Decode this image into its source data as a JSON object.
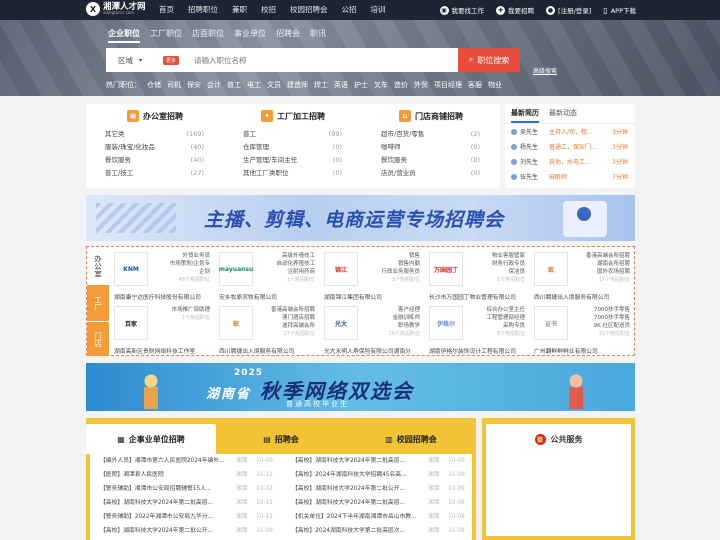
{
  "brand": {
    "name_cn": "湘潭人才网",
    "name_en": "xiangtanrc.com",
    "mark": "X"
  },
  "topnav": [
    "首页",
    "招聘职位",
    "兼职",
    "校招",
    "校园招聘会",
    "公招",
    "培训"
  ],
  "topright": {
    "find_job": "我要找工作",
    "hire": "我要招聘",
    "login": "[注册/登录]",
    "app": "APP下载"
  },
  "search": {
    "tabs": [
      "企业职位",
      "工厂职位",
      "店面职位",
      "事业单位",
      "招聘会",
      "职讯"
    ],
    "region_label": "区域",
    "more_badge": "更多",
    "placeholder": "请输入职位名称",
    "button": "职位搜索",
    "advanced": "高级搜索"
  },
  "hot": {
    "label": "热门职位：",
    "items": [
      "仓储",
      "司机",
      "保安",
      "会计",
      "普工",
      "电工",
      "文员",
      "建造师",
      "焊工",
      "英语",
      "护士",
      "叉车",
      "造价",
      "外贸",
      "项目经理",
      "客服",
      "物业"
    ]
  },
  "categories": [
    {
      "title": "办公室招聘",
      "icon": "briefcase-icon",
      "rows": [
        [
          "其它类",
          "(169)"
        ],
        [
          "服装/珠宝/化妆品",
          "(40)"
        ],
        [
          "餐饮服务",
          "(40)"
        ],
        [
          "普工/技工",
          "(27)"
        ]
      ]
    },
    {
      "title": "工厂加工招聘",
      "icon": "wrench-icon",
      "rows": [
        [
          "普工",
          "(99)"
        ],
        [
          "仓库管理",
          "(0)"
        ],
        [
          "生产管理/车间主任",
          "(0)"
        ],
        [
          "其他工厂类职位",
          "(0)"
        ]
      ]
    },
    {
      "title": "门店商铺招聘",
      "icon": "store-icon",
      "rows": [
        [
          "超市/百货/零售",
          "(2)"
        ],
        [
          "咖啡师",
          "(0)"
        ],
        [
          "餐饮服务",
          "(0)"
        ],
        [
          "店员/营业员",
          "(0)"
        ]
      ]
    }
  ],
  "resume": {
    "tabs": [
      "最新简历",
      "最新动态"
    ],
    "rows": [
      {
        "name": "吴先生",
        "job": "主持人/司，租...",
        "time": "3分钟"
      },
      {
        "name": "杨先生",
        "job": "普通工，保安门...",
        "time": "3分钟"
      },
      {
        "name": "刘先生",
        "job": "其他，水电工...",
        "time": "3分钟"
      },
      {
        "name": "伍先生",
        "job": "麻醉师",
        "time": "7分钟"
      }
    ]
  },
  "banner1": {
    "text": "主播、剪辑、电商运营专场招聘会"
  },
  "logo_side": {
    "office": "办公室",
    "factory": "工厂",
    "store": "门店"
  },
  "companies": [
    {
      "logo": "KNM",
      "color": "#1a55a5",
      "jobs": [
        "外贸业务员",
        "市场策划/企划专",
        "企划"
      ],
      "hot": "46个热招职位",
      "name": "湖南康宁达医疗科技股份有限公司"
    },
    {
      "logo": "mayuansu",
      "color": "#1a8a6a",
      "jobs": [
        "高级外墙技工",
        "自动化养殖技工",
        "注射用药商"
      ],
      "hot": "1个热招职位",
      "name": "安乡牧原农牧有限公司"
    },
    {
      "logo": "锦江",
      "color": "#c8362a",
      "jobs": [
        "销售",
        "销售内勤",
        "行政业务服务员"
      ],
      "hot": "3个热招职位",
      "name": "湖南锦江集团有限公司"
    },
    {
      "logo": "万国园丁",
      "color": "#cc2a2a",
      "jobs": [
        "物业客服管家",
        "财务行政专员",
        "保洁员"
      ],
      "hot": "1个热招职位",
      "name": "长沙市万国园丁物业管理有限公司"
    },
    {
      "logo": "蚁",
      "color": "#e8712a",
      "jobs": [
        "香港高端会所招聘",
        "湖南会所招聘",
        "国外农场招聘"
      ],
      "hot": "17个热招职位",
      "name": "西川聘捷出入境服务有限公司"
    },
    {
      "logo": "百家",
      "color": "#222",
      "jobs": [
        "市场推广部助理"
      ],
      "hot": "1个热招职位",
      "name": "湖南高新区贵财网络科技工作室"
    },
    {
      "logo": "蚁",
      "color": "#e8712a",
      "jobs": [
        "香港高端会所招聘",
        "澳门酒店招聘",
        "迪拜高端会所"
      ],
      "hot": "17个热招职位",
      "name": "西川聘捷出入境服务有限公司"
    },
    {
      "logo": "光大",
      "color": "#2d5c8a",
      "jobs": [
        "客户经理",
        "金融训练师",
        "职场教学"
      ],
      "hot": "16个热招职位",
      "name": "光大永明人寿保险有限公司湖南分"
    },
    {
      "logo": "伊格尔",
      "color": "#6a8fc8",
      "jobs": [
        "综合办公室主任",
        "工程管理部经理",
        "采购专员"
      ],
      "hot": "8个热招职位",
      "name": "湖南伊格尔装饰设计工程有限公司"
    },
    {
      "logo": "证书",
      "color": "#999",
      "jobs": [
        "7000扶手零售",
        "7000扶手零售",
        "9K 社区配送员"
      ],
      "hot": "31个热招职位",
      "name": "广州翻鲜鲜鲜业有限公司"
    }
  ],
  "banner2": {
    "year": "2025",
    "prefix": "湖南省",
    "title": "秋季网络双选会",
    "sub": "普通高校毕业生"
  },
  "bottom": {
    "tabs": [
      "企事业单位招聘",
      "招聘会",
      "校园招聘会"
    ],
    "left": [
      {
        "t": "【编外人员】湘潭市第六人民医院2024年编外...",
        "s": "湘潭",
        "d": "10-09"
      },
      {
        "t": "【医院】湘潭县人民医院",
        "s": "湘潭",
        "d": "10-12"
      },
      {
        "t": "【警务辅助】湘潭市公安局招聘辅警15人...",
        "s": "湘潭",
        "d": "10-12"
      },
      {
        "t": "【高校】湖南科技大学2024年第二批高层...",
        "s": "湘潭",
        "d": "10-11"
      },
      {
        "t": "【警务辅助】2022年湘潭市公安局九华分...",
        "s": "湘潭",
        "d": "10-11"
      },
      {
        "t": "【高校】湖南科技大学2024年第二批公开...",
        "s": "湘潭",
        "d": "10-09"
      }
    ],
    "right": [
      {
        "t": "【高校】湖南科技大学2024年第二批高层...",
        "s": "湘潭",
        "d": "10-09"
      },
      {
        "t": "【高校】2024年湖南科技大学招聘45名高...",
        "s": "湘潭",
        "d": "10-09"
      },
      {
        "t": "【高校】湖南科技大学2024年第二批公开...",
        "s": "湘潭",
        "d": "10-09"
      },
      {
        "t": "【高校】湖南科技大学2024年第二批高层...",
        "s": "湘潭",
        "d": "10-08"
      },
      {
        "t": "【机关单位】2024下半年湖南湘潭市岳山市教...",
        "s": "湘潭",
        "d": "10-08"
      },
      {
        "t": "【高校】2024湖南科技大学第二批高层次...",
        "s": "湘潭",
        "d": "10-08"
      }
    ]
  },
  "public": {
    "title": "公共服务",
    "emblem": "徽"
  }
}
